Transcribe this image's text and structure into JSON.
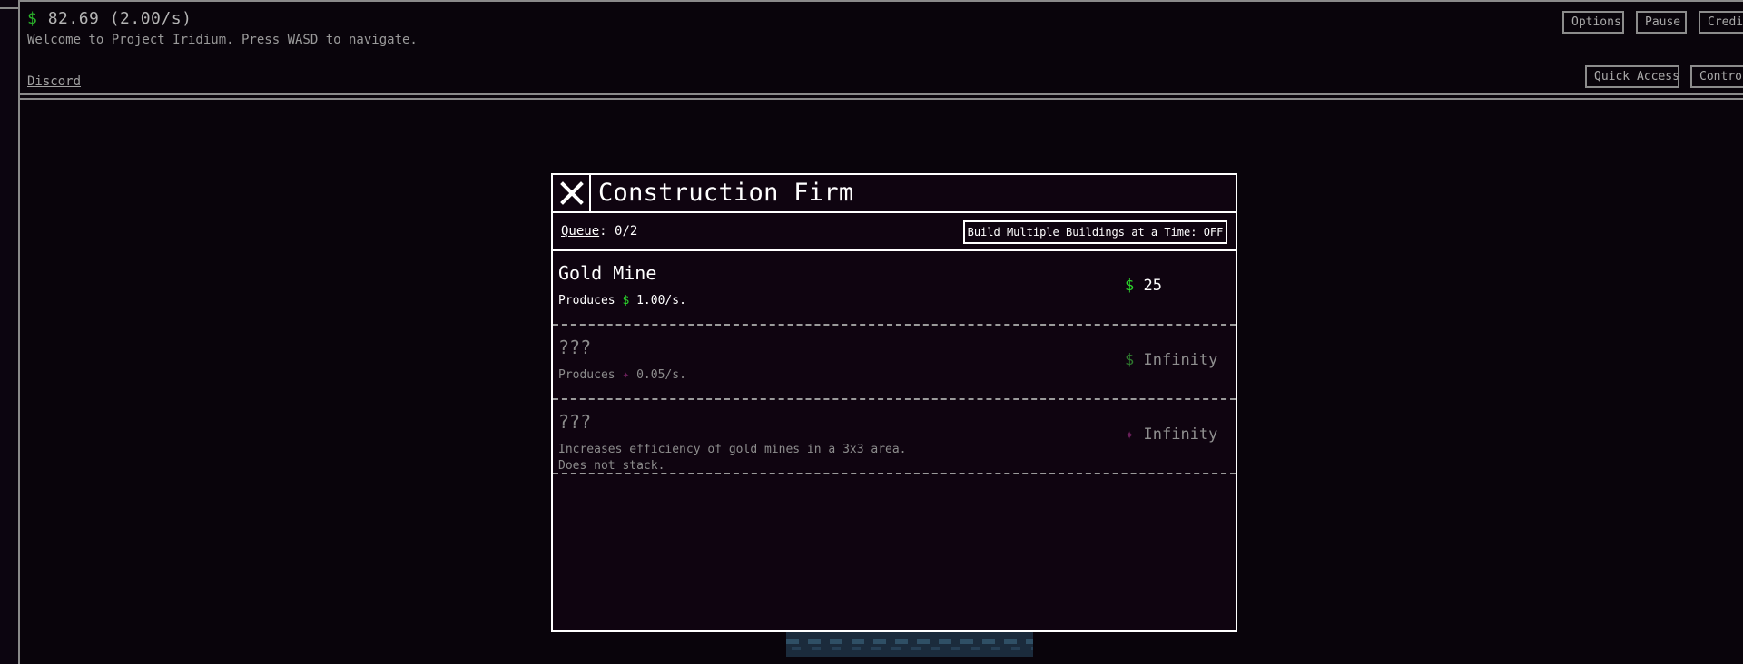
{
  "header": {
    "money_symbol": "$",
    "money_text": "82.69 (2.00/s)",
    "welcome": "Welcome to Project Iridium. Press WASD to navigate.",
    "discord": "Discord",
    "buttons": {
      "options": "Options",
      "pause": "Pause",
      "credits": "Credits",
      "quick_access": "Quick Access",
      "controls": "Controls"
    }
  },
  "modal": {
    "title": "Construction Firm",
    "queue_label": "Queue",
    "queue_value": ": 0/2",
    "multi_build_button": "Build Multiple Buildings at a Time: OFF",
    "items": [
      {
        "name": "Gold Mine",
        "desc_prefix": "Produces ",
        "desc_symbol": "$",
        "desc_suffix": " 1.00/s.",
        "cost_symbol": "$",
        "cost_value": "25",
        "locked": false
      },
      {
        "name": "???",
        "desc_prefix": "Produces ",
        "desc_symbol": "✦",
        "desc_suffix": " 0.05/s.",
        "cost_symbol": "$",
        "cost_value": "Infinity",
        "locked": true
      },
      {
        "name": "???",
        "desc_line1": "Increases efficiency of gold mines in a 3x3 area.",
        "desc_line2": "Does not stack.",
        "cost_symbol": "✦",
        "cost_value": "Infinity",
        "locked": true
      }
    ]
  },
  "colors": {
    "background": "#09040b",
    "modal_bg": "#0f0410",
    "money_green": "#2bd42b",
    "iridium_purple": "#6a1f5a",
    "border": "#ffffff"
  },
  "icons": {
    "close": "close-icon"
  }
}
